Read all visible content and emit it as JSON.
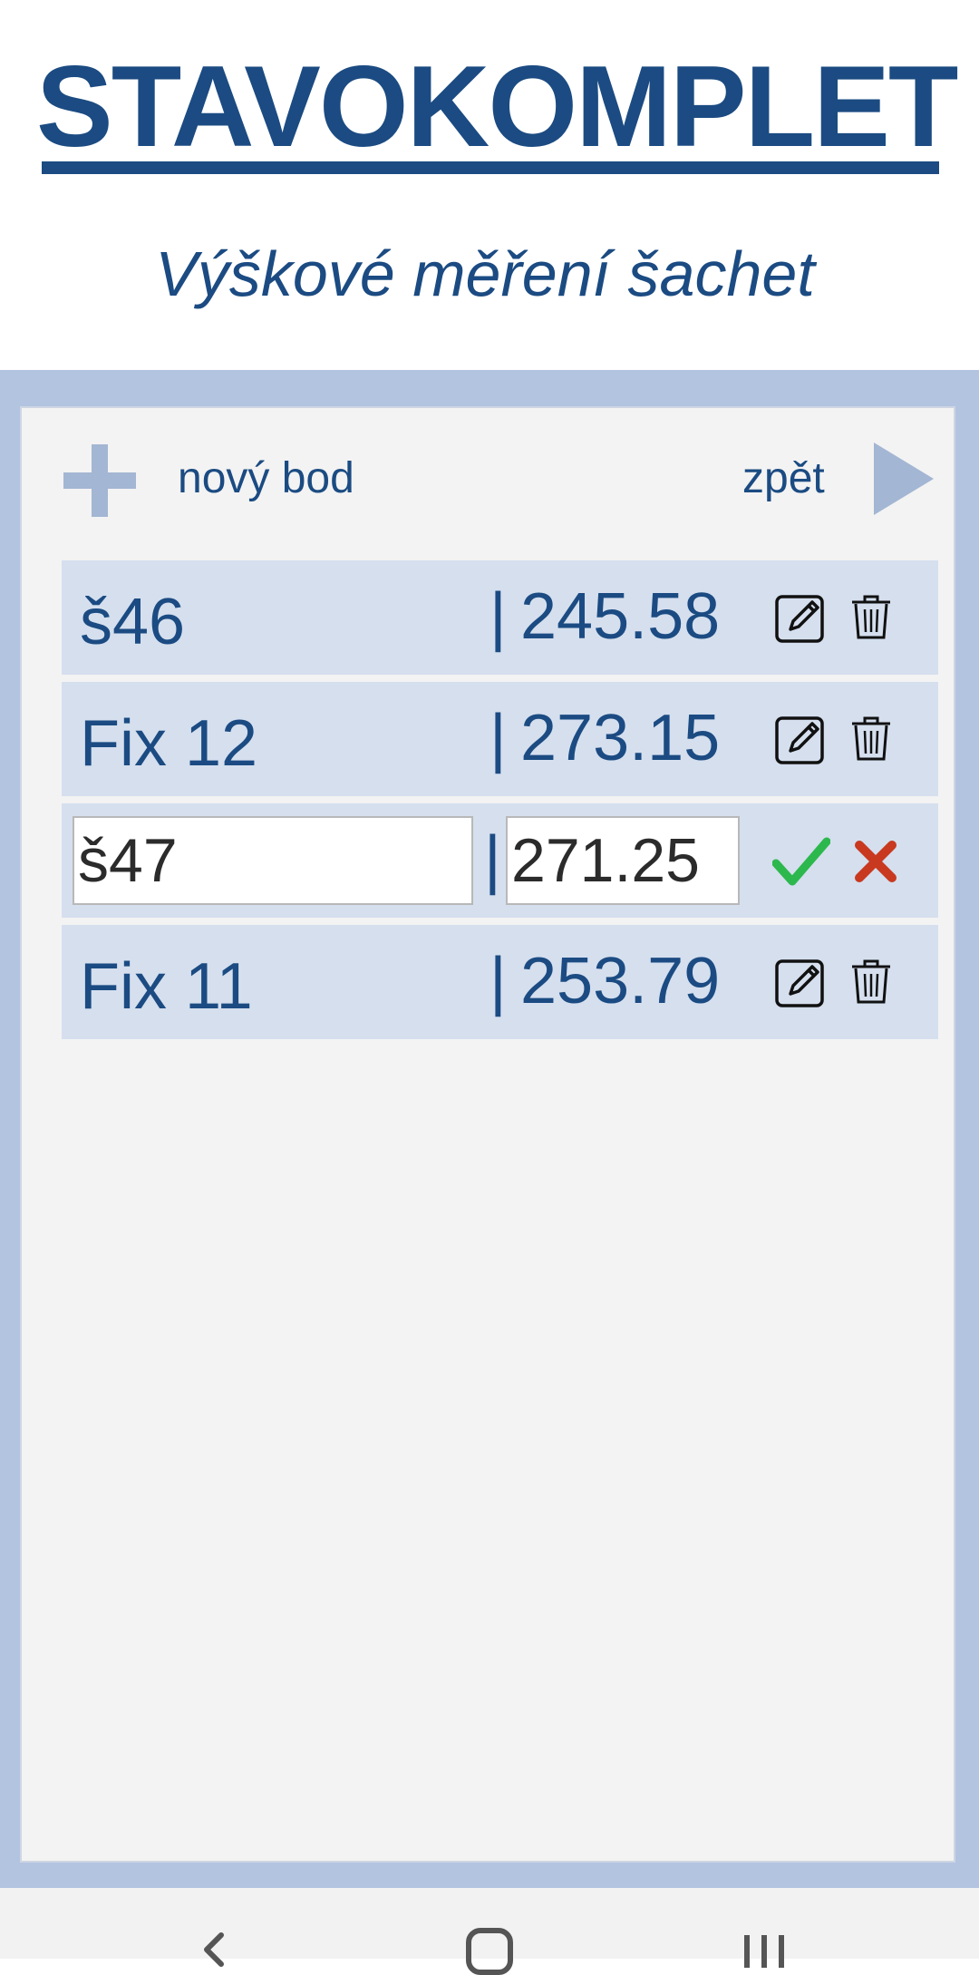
{
  "header": {
    "logo_text": "STAVOKOMPLET",
    "subtitle": "Výškové měření šachet"
  },
  "toolbar": {
    "new_label": "nový bod",
    "back_label": "zpět",
    "add_icon": "plus-icon",
    "back_icon": "play-icon"
  },
  "rows": [
    {
      "name": "š46",
      "separator": "|",
      "value": "245.58",
      "mode": "view"
    },
    {
      "name": "Fix 12",
      "separator": "|",
      "value": "273.15",
      "mode": "view"
    },
    {
      "name": "š47",
      "separator": "|",
      "value": "271.25",
      "mode": "edit"
    },
    {
      "name": "Fix 11",
      "separator": "|",
      "value": "253.79",
      "mode": "view"
    }
  ],
  "colors": {
    "brand": "#1b4b82",
    "frame": "#b3c4e0",
    "row": "#d5dfee",
    "confirm": "#2db84d",
    "cancel": "#c8391f"
  }
}
